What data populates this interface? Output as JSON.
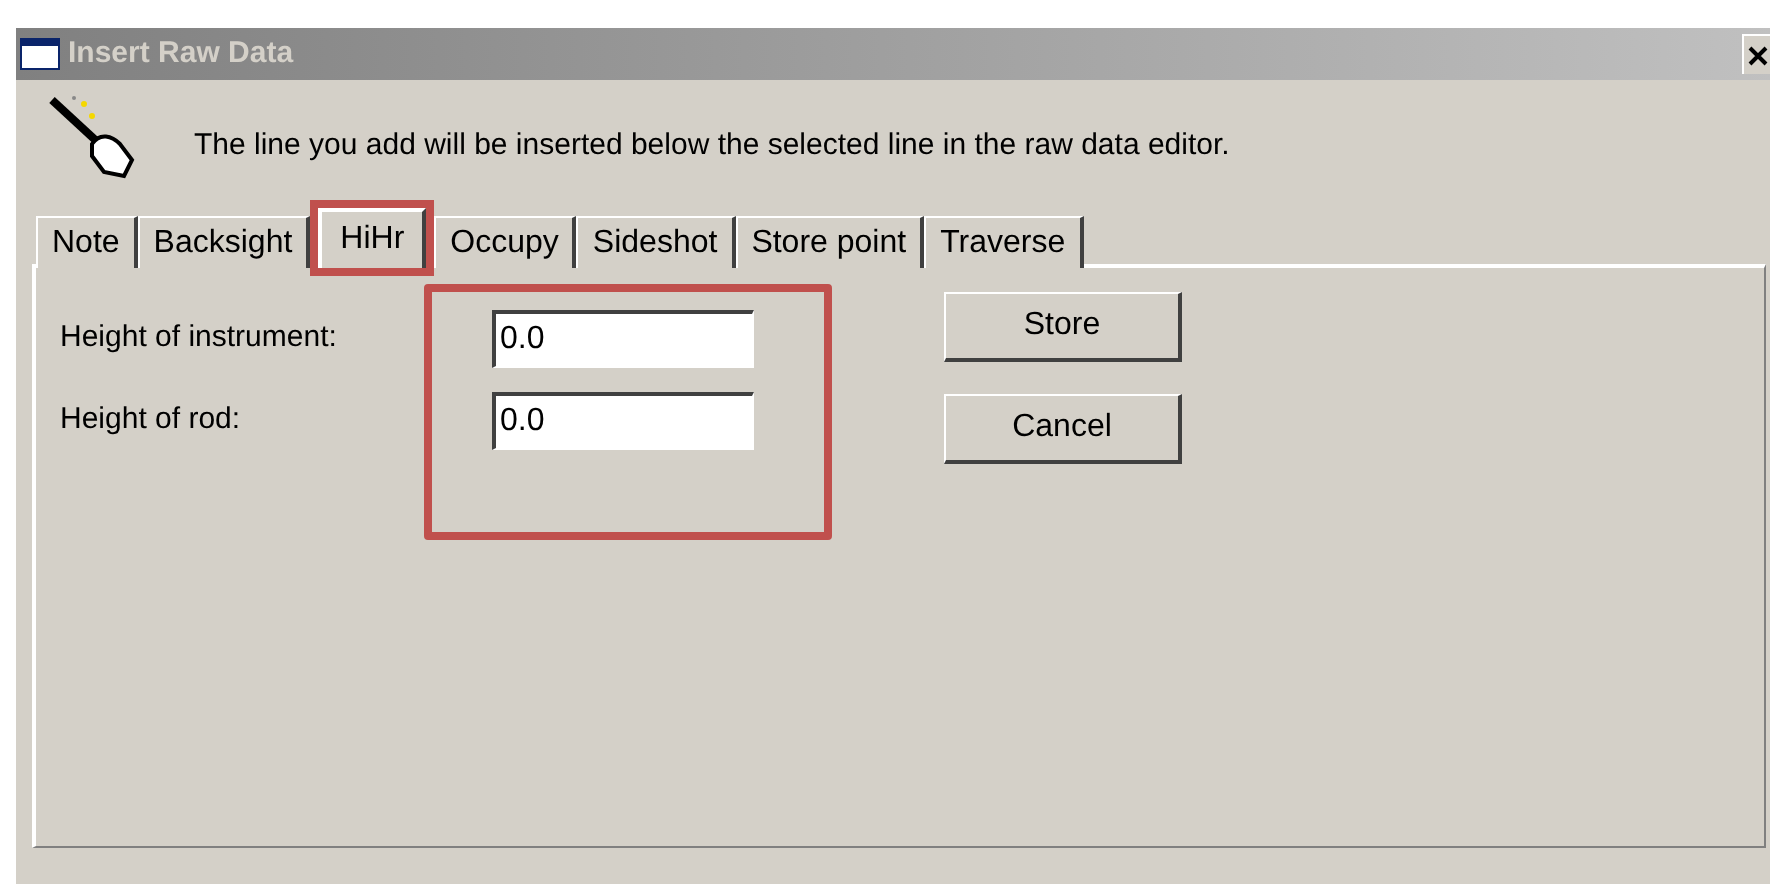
{
  "window": {
    "title": "Insert Raw Data",
    "active": false
  },
  "info": "The line you add will be inserted below the selected line in the raw data editor.",
  "tabs": [
    {
      "label": "Note",
      "selected": false,
      "highlighted": false
    },
    {
      "label": "Backsight",
      "selected": false,
      "highlighted": false
    },
    {
      "label": "HiHr",
      "selected": true,
      "highlighted": true
    },
    {
      "label": "Occupy",
      "selected": false,
      "highlighted": false
    },
    {
      "label": "Sideshot",
      "selected": false,
      "highlighted": false
    },
    {
      "label": "Store point",
      "selected": false,
      "highlighted": false
    },
    {
      "label": "Traverse",
      "selected": false,
      "highlighted": false
    }
  ],
  "fields_highlighted": true,
  "fields": [
    {
      "label": "Height of instrument:",
      "value": "0.0"
    },
    {
      "label": "Height of rod:",
      "value": "0.0"
    }
  ],
  "buttons": [
    "Store",
    "Cancel"
  ]
}
